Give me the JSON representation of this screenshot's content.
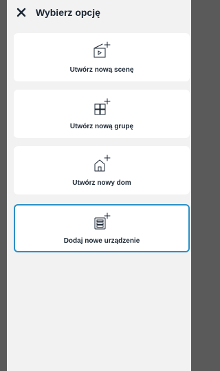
{
  "header": {
    "title": "Wybierz opcję",
    "close_icon": "close-icon"
  },
  "options": [
    {
      "label": "Utwórz nową scenę",
      "icon": "scene-add-icon",
      "selected": false
    },
    {
      "label": "Utwórz nową grupę",
      "icon": "group-add-icon",
      "selected": false
    },
    {
      "label": "Utwórz nowy dom",
      "icon": "home-add-icon",
      "selected": false
    },
    {
      "label": "Dodaj nowe urządzenie",
      "icon": "device-add-icon",
      "selected": true
    }
  ],
  "colors": {
    "accent": "#2a90c6",
    "text": "#1a2633",
    "background": "#f2f2f2",
    "card": "#ffffff",
    "overlay": "#5a5a5a"
  }
}
